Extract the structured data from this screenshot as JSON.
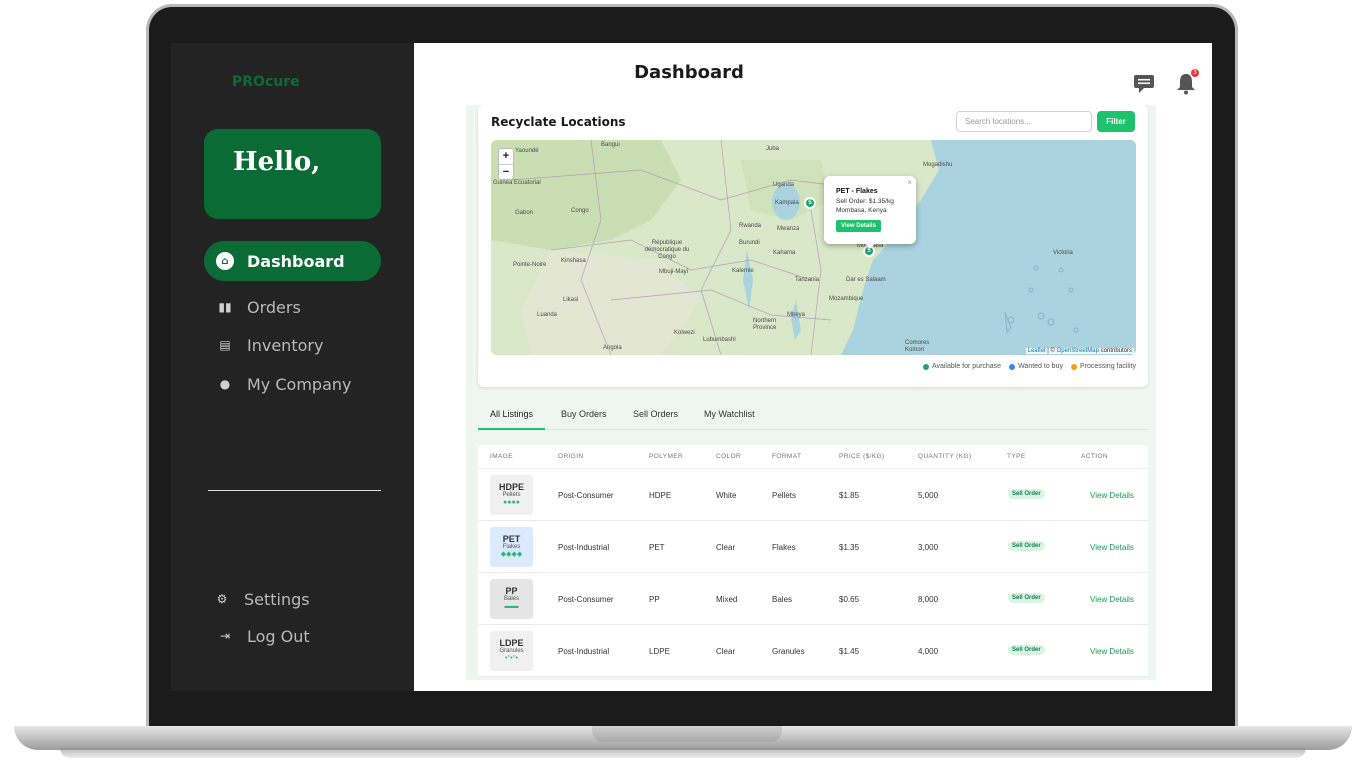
{
  "app": {
    "brand": "PROcure",
    "greeting": "Hello,"
  },
  "sidebar": {
    "items": [
      {
        "label": "Dashboard",
        "icon": "home-icon",
        "active": true
      },
      {
        "label": "Orders",
        "icon": "bar-chart-icon"
      },
      {
        "label": "Inventory",
        "icon": "document-icon"
      },
      {
        "label": "My Company",
        "icon": "user-icon"
      }
    ],
    "bottom": [
      {
        "label": "Settings",
        "icon": "user-settings-icon"
      },
      {
        "label": "Log Out",
        "icon": "logout-icon"
      }
    ]
  },
  "header": {
    "title": "Dashboard",
    "notification_count": "3"
  },
  "map_section": {
    "title": "Recyclate Locations",
    "search_placeholder": "Search locations...",
    "filter_label": "Filter",
    "zoom_in": "+",
    "zoom_out": "−",
    "places": [
      "Bangui",
      "Juba",
      "Mogadishu",
      "Uganda",
      "Kampala",
      "Gabon",
      "Congo",
      "Rwanda",
      "Burundi",
      "Mwanza",
      "République démocratique du Congo",
      "Kinshasa",
      "Pointe-Noire",
      "Mbuji-Mayi",
      "Kalemie",
      "Kahama",
      "Tanzania",
      "Dar es Salaam",
      "Mombasa",
      "Luanda",
      "Likasi",
      "Kolwezi",
      "Lubumbashi",
      "Mbeya",
      "Angola",
      "Northern Province",
      "Mozambique",
      "Victoria",
      "Comores Komori",
      "Yaoundé",
      "Guinea Ecuatorial"
    ],
    "markers": [
      {
        "label": "5",
        "color": "#1ea46b"
      },
      {
        "label": "5",
        "color": "#1ea46b"
      }
    ],
    "popup": {
      "title": "PET - Flakes",
      "line1": "Sell Order: $1.35/kg",
      "line2": "Mombasa, Kenya",
      "button": "View Details",
      "close": "×"
    },
    "attribution_leaflet": "Leaflet",
    "attribution_rest": " | © ",
    "attribution_osm": "OpenStreetMap",
    "attribution_end": " contributors",
    "legend": [
      {
        "label": "Available for purchase",
        "color": "#1ea46b"
      },
      {
        "label": "Wanted to buy",
        "color": "#3b82f6"
      },
      {
        "label": "Processing facility",
        "color": "#f59e0b"
      }
    ]
  },
  "tabs": [
    "All Listings",
    "Buy Orders",
    "Sell Orders",
    "My Watchlist"
  ],
  "table": {
    "columns": [
      "IMAGE",
      "ORIGIN",
      "POLYMER",
      "COLOR",
      "FORMAT",
      "PRICE ($/KG)",
      "QUANTITY (KG)",
      "TYPE",
      "ACTION"
    ],
    "rows": [
      {
        "thumb_polymer": "HDPE",
        "thumb_format": "Pellets",
        "thumb_marks": "●●●●",
        "thumb_bg": "#f0f0f0",
        "origin": "Post-Consumer",
        "polymer": "HDPE",
        "color": "White",
        "format": "Pellets",
        "price": "$1.85",
        "quantity": "5,000",
        "type": "Sell Order",
        "action": "View Details"
      },
      {
        "thumb_polymer": "PET",
        "thumb_format": "Flakes",
        "thumb_marks": "◆◆◆◆",
        "thumb_bg": "#dbeafe",
        "origin": "Post-Industrial",
        "polymer": "PET",
        "color": "Clear",
        "format": "Flakes",
        "price": "$1.35",
        "quantity": "3,000",
        "type": "Sell Order",
        "action": "View Details"
      },
      {
        "thumb_polymer": "PP",
        "thumb_format": "Bales",
        "thumb_marks": "▬▬",
        "thumb_bg": "#e5e5e5",
        "origin": "Post-Consumer",
        "polymer": "PP",
        "color": "Mixed",
        "format": "Bales",
        "price": "$0.65",
        "quantity": "8,000",
        "type": "Sell Order",
        "action": "View Details"
      },
      {
        "thumb_polymer": "LDPE",
        "thumb_format": "Granules",
        "thumb_marks": "•°•°•",
        "thumb_bg": "#f0f0f0",
        "origin": "Post-Industrial",
        "polymer": "LDPE",
        "color": "Clear",
        "format": "Granules",
        "price": "$1.45",
        "quantity": "4,000",
        "type": "Sell Order",
        "action": "View Details"
      }
    ]
  }
}
